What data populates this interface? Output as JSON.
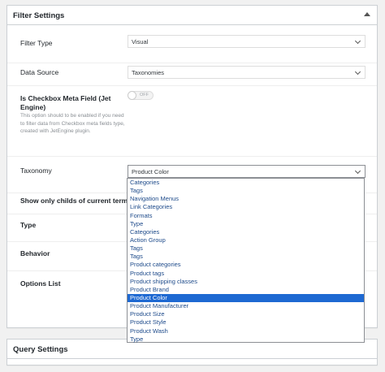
{
  "filter_panel": {
    "title": "Filter Settings",
    "filter_type": {
      "label": "Filter Type",
      "value": "Visual"
    },
    "data_source": {
      "label": "Data Source",
      "value": "Taxonomies"
    },
    "checkbox_meta": {
      "label": "Is Checkbox Meta Field (Jet Engine)",
      "description": "This option should to be enabled if you need to filter data from Checkbox meta fields type, created with JetEngine plugin.",
      "toggle_text": "OFF"
    },
    "taxonomy": {
      "label": "Taxonomy",
      "value": "Product Color",
      "options": [
        "Categories",
        "Tags",
        "Navigation Menus",
        "Link Categories",
        "Formats",
        "Type",
        "Categories",
        "Action Group",
        "Tags",
        "Tags",
        "Product categories",
        "Product tags",
        "Product shipping classes",
        "Product Brand",
        "Product Color",
        "Product Manufacturer",
        "Product Size",
        "Product Style",
        "Product Wash",
        "Type"
      ],
      "selected_index": 14
    },
    "childs_label": "Show only childs of current term",
    "type_label": "Type",
    "behavior_label": "Behavior",
    "options_list_label": "Options List"
  },
  "query_panel": {
    "title": "Query Settings"
  }
}
